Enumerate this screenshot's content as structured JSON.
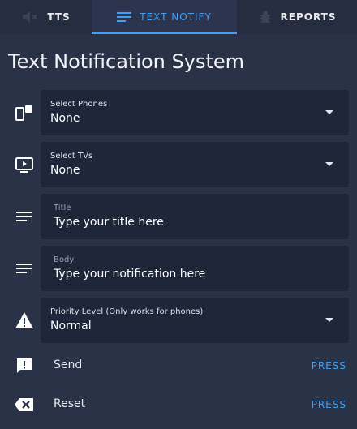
{
  "tabs": [
    {
      "label": "TTS",
      "icon": "speaker-muted-icon",
      "active": false
    },
    {
      "label": "TEXT NOTIFY",
      "icon": "text-lines-icon",
      "active": true
    },
    {
      "label": "REPORTS",
      "icon": "bug-icon",
      "active": false
    }
  ],
  "page_title": "Text Notification System",
  "fields": {
    "phones": {
      "label": "Select Phones",
      "value": "None",
      "icon": "phone-tablet-icon"
    },
    "tvs": {
      "label": "Select TVs",
      "value": "None",
      "icon": "tv-play-icon"
    },
    "title": {
      "label": "Title",
      "placeholder": "Type your title here",
      "icon": "text-lines-icon"
    },
    "body": {
      "label": "Body",
      "placeholder": "Type your notification here",
      "icon": "text-lines-icon"
    },
    "priority": {
      "label": "Priority Level (Only works for phones)",
      "value": "Normal",
      "icon": "warning-icon"
    }
  },
  "actions": {
    "send": {
      "label": "Send",
      "button": "PRESS",
      "icon": "message-alert-icon"
    },
    "reset": {
      "label": "Reset",
      "button": "PRESS",
      "icon": "backspace-icon"
    }
  },
  "colors": {
    "accent": "#41a0f0",
    "background": "#2a3247",
    "field_background": "#1f2639",
    "tabbar": "#262d40"
  }
}
